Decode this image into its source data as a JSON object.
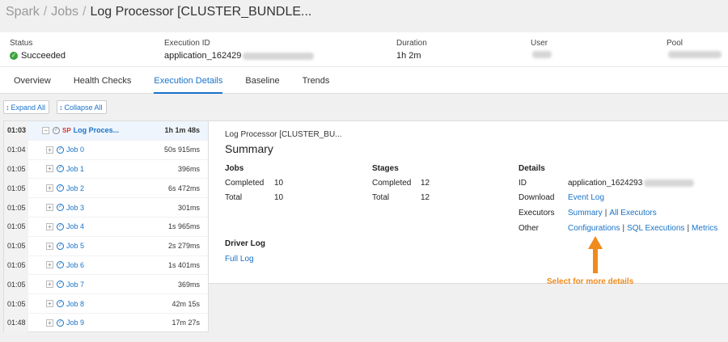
{
  "breadcrumb": {
    "items": [
      "Spark",
      "Jobs"
    ],
    "current": "Log Processor [CLUSTER_BUNDLE..."
  },
  "info": {
    "status": {
      "label": "Status",
      "value": "Succeeded"
    },
    "execution_id": {
      "label": "Execution ID",
      "value": "application_162429"
    },
    "duration": {
      "label": "Duration",
      "value": "1h 2m"
    },
    "user": {
      "label": "User"
    },
    "pool": {
      "label": "Pool"
    }
  },
  "tabs": [
    {
      "label": "Overview"
    },
    {
      "label": "Health Checks"
    },
    {
      "label": "Execution Details"
    },
    {
      "label": "Baseline"
    },
    {
      "label": "Trends"
    }
  ],
  "toolbar": {
    "expand_label": "Expand All",
    "collapse_label": "Collapse All"
  },
  "tree": {
    "root": {
      "time": "01:03",
      "badge": "SP",
      "name": "Log Proces...",
      "duration": "1h 1m 48s"
    },
    "rows": [
      {
        "time": "01:04",
        "name": "Job 0",
        "duration": "50s 915ms"
      },
      {
        "time": "01:05",
        "name": "Job 1",
        "duration": "396ms"
      },
      {
        "time": "01:05",
        "name": "Job 2",
        "duration": "6s 472ms"
      },
      {
        "time": "01:05",
        "name": "Job 3",
        "duration": "301ms"
      },
      {
        "time": "01:05",
        "name": "Job 4",
        "duration": "1s 965ms"
      },
      {
        "time": "01:05",
        "name": "Job 5",
        "duration": "2s 279ms"
      },
      {
        "time": "01:05",
        "name": "Job 6",
        "duration": "1s 401ms"
      },
      {
        "time": "01:05",
        "name": "Job 7",
        "duration": "369ms"
      },
      {
        "time": "01:05",
        "name": "Job 8",
        "duration": "42m 15s"
      },
      {
        "time": "01:48",
        "name": "Job 9",
        "duration": "17m 27s"
      }
    ]
  },
  "detail": {
    "subtitle": "Log Processor [CLUSTER_BU...",
    "title": "Summary",
    "jobs": {
      "title": "Jobs",
      "completed_label": "Completed",
      "completed": "10",
      "total_label": "Total",
      "total": "10"
    },
    "stages": {
      "title": "Stages",
      "completed_label": "Completed",
      "completed": "12",
      "total_label": "Total",
      "total": "12"
    },
    "details": {
      "title": "Details",
      "id_label": "ID",
      "id_value": "application_1624293",
      "download_label": "Download",
      "event_log": "Event Log",
      "executors_label": "Executors",
      "summary_link": "Summary",
      "all_executors_link": "All Executors",
      "other_label": "Other",
      "configurations_link": "Configurations",
      "sql_link": "SQL Executions",
      "metrics_link": "Metrics",
      "separator": "|"
    },
    "driver_log": {
      "title": "Driver Log",
      "full_log": "Full Log"
    }
  },
  "annotation": {
    "text": "Select for more details",
    "color": "#f08a1d"
  }
}
